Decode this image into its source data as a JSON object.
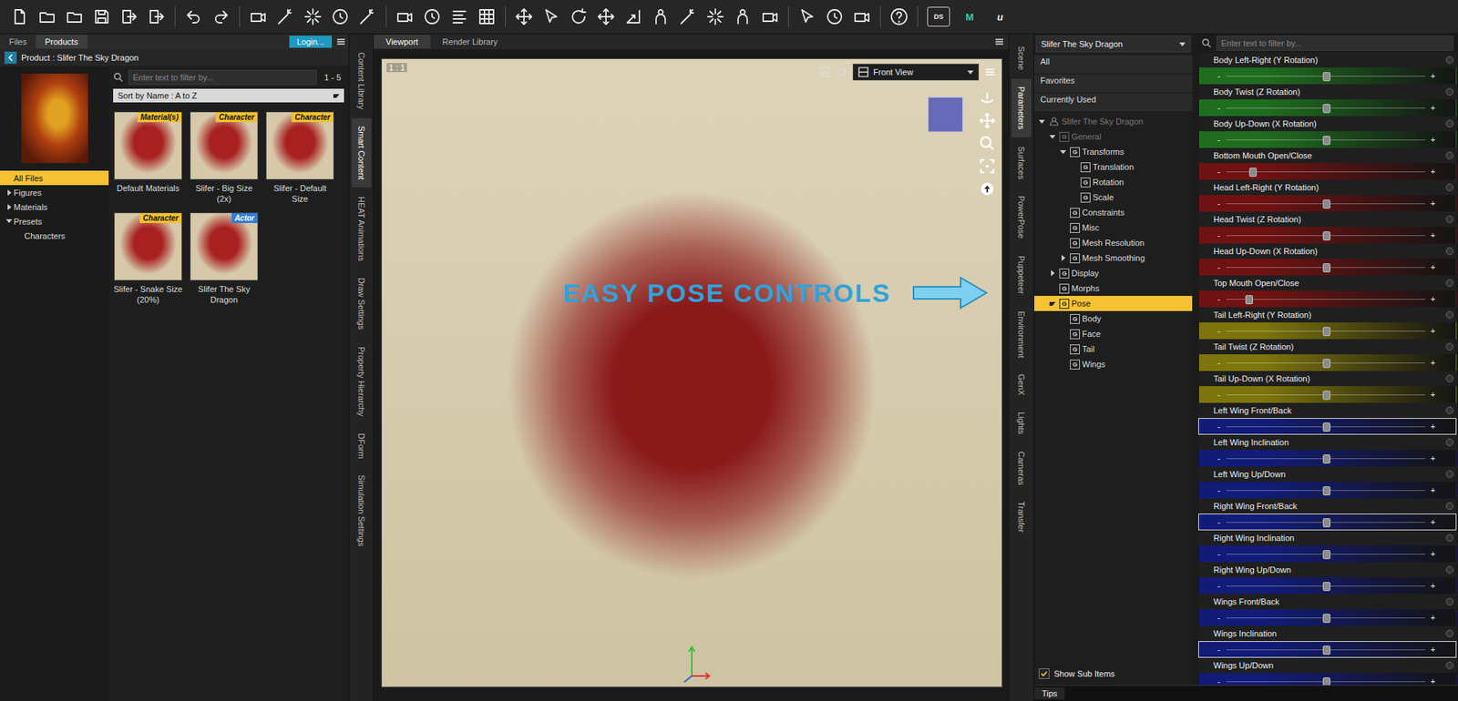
{
  "toolbar": {
    "tagged_icons": [
      {
        "label": "DS"
      },
      {
        "label": "M"
      },
      {
        "label": "u"
      }
    ]
  },
  "content_panel": {
    "tabs": [
      {
        "label": "Files",
        "selected": false
      },
      {
        "label": "Products",
        "selected": true
      }
    ],
    "login": "Login...",
    "breadcrumb": "Product : Slifer The Sky Dragon",
    "filter": {
      "placeholder": "Enter text to filter by...",
      "count": "1 - 5"
    },
    "sort": "Sort by Name : A to Z",
    "tree": [
      {
        "label": "All Files",
        "depth": 0,
        "expandable": false,
        "expanded": false,
        "selected": true
      },
      {
        "label": "Figures",
        "depth": 0,
        "expandable": true,
        "expanded": false,
        "selected": false
      },
      {
        "label": "Materials",
        "depth": 0,
        "expandable": true,
        "expanded": false,
        "selected": false
      },
      {
        "label": "Presets",
        "depth": 0,
        "expandable": true,
        "expanded": true,
        "selected": false
      },
      {
        "label": "Characters",
        "depth": 1,
        "expandable": false,
        "expanded": false,
        "selected": false
      }
    ],
    "items": [
      {
        "name": "Default Materials",
        "badge": "Material(s)",
        "color": "#f2c12e"
      },
      {
        "name": "Slifer - Big Size (2x)",
        "badge": "Character",
        "color": "#f2c12e"
      },
      {
        "name": "Slifer - Default Size",
        "badge": "Character",
        "color": "#f2c12e"
      },
      {
        "name": "Slifer - Snake Size (20%)",
        "badge": "Character",
        "color": "#f2c12e"
      },
      {
        "name": "Slifer The Sky Dragon",
        "badge": "Actor",
        "color": "#2f7fd8"
      }
    ]
  },
  "left_tabs": [
    {
      "label": "Content Library",
      "selected": false
    },
    {
      "label": "Smart Content",
      "selected": true
    },
    {
      "label": "HEAT Animations",
      "selected": false
    },
    {
      "label": "Draw Settings",
      "selected": false
    },
    {
      "label": "Property Hierarchy",
      "selected": false
    },
    {
      "label": "DForm",
      "selected": false
    },
    {
      "label": "Simulation Settings",
      "selected": false
    }
  ],
  "viewport": {
    "tabs": [
      {
        "label": "Viewport",
        "selected": true
      },
      {
        "label": "Render Library",
        "selected": false
      }
    ],
    "zoom": "1 : 1",
    "view": "Front View",
    "callout": "EASY POSE CONTROLS"
  },
  "right_tabs": [
    {
      "label": "Scene",
      "selected": false
    },
    {
      "label": "Parameters",
      "selected": true
    },
    {
      "label": "Surfaces",
      "selected": false
    },
    {
      "label": "PowerPose",
      "selected": false
    },
    {
      "label": "Puppeteer",
      "selected": false
    },
    {
      "label": "Environment",
      "selected": false
    },
    {
      "label": "GenX",
      "selected": false
    },
    {
      "label": "Lights",
      "selected": false
    },
    {
      "label": "Cameras",
      "selected": false
    },
    {
      "label": "Transfer",
      "selected": false
    }
  ],
  "parameters": {
    "node": "Slifer The Sky Dragon",
    "quick": [
      {
        "label": "All",
        "selected": false
      },
      {
        "label": "Favorites",
        "selected": false
      },
      {
        "label": "Currently Used",
        "selected": false
      }
    ],
    "group_badge": "G",
    "tree": [
      {
        "label": "Slifer The Sky Dragon",
        "kind": "figure",
        "depth": 0,
        "expandable": true,
        "expanded": true,
        "selected": false,
        "greyed": true
      },
      {
        "label": "General",
        "kind": "group",
        "depth": 1,
        "expandable": true,
        "expanded": true,
        "selected": false,
        "greyed": true
      },
      {
        "label": "Transforms",
        "kind": "group",
        "depth": 2,
        "expandable": true,
        "expanded": true,
        "selected": false,
        "greyed": false
      },
      {
        "label": "Translation",
        "kind": "group",
        "depth": 3,
        "expandable": false,
        "expanded": false,
        "selected": false,
        "greyed": false
      },
      {
        "label": "Rotation",
        "kind": "group",
        "depth": 3,
        "expandable": false,
        "expanded": false,
        "selected": false,
        "greyed": false
      },
      {
        "label": "Scale",
        "kind": "group",
        "depth": 3,
        "expandable": false,
        "expanded": false,
        "selected": false,
        "greyed": false
      },
      {
        "label": "Constraints",
        "kind": "group",
        "depth": 2,
        "expandable": false,
        "expanded": false,
        "selected": false,
        "greyed": false
      },
      {
        "label": "Misc",
        "kind": "group",
        "depth": 2,
        "expandable": false,
        "expanded": false,
        "selected": false,
        "greyed": false
      },
      {
        "label": "Mesh Resolution",
        "kind": "group",
        "depth": 2,
        "expandable": false,
        "expanded": false,
        "selected": false,
        "greyed": false
      },
      {
        "label": "Mesh Smoothing",
        "kind": "group",
        "depth": 2,
        "expandable": true,
        "expanded": false,
        "selected": false,
        "greyed": false
      },
      {
        "label": "Display",
        "kind": "group",
        "depth": 1,
        "expandable": true,
        "expanded": false,
        "selected": false,
        "greyed": false
      },
      {
        "label": "Morphs",
        "kind": "group",
        "depth": 1,
        "expandable": false,
        "expanded": false,
        "selected": false,
        "greyed": false
      },
      {
        "label": "Pose",
        "kind": "group",
        "depth": 1,
        "expandable": true,
        "expanded": true,
        "selected": true,
        "greyed": false
      },
      {
        "label": "Body",
        "kind": "group",
        "depth": 2,
        "expandable": false,
        "expanded": false,
        "selected": false,
        "greyed": false
      },
      {
        "label": "Face",
        "kind": "group",
        "depth": 2,
        "expandable": false,
        "expanded": false,
        "selected": false,
        "greyed": false
      },
      {
        "label": "Tail",
        "kind": "group",
        "depth": 2,
        "expandable": false,
        "expanded": false,
        "selected": false,
        "greyed": false
      },
      {
        "label": "Wings",
        "kind": "group",
        "depth": 2,
        "expandable": false,
        "expanded": false,
        "selected": false,
        "greyed": false
      }
    ],
    "show_sub_items": {
      "label": "Show Sub Items",
      "checked": true
    },
    "filter": {
      "placeholder": "Enter text to filter by..."
    },
    "slider_minus": "-",
    "slider_plus": "+",
    "sliders": [
      {
        "name": "Body Left-Right (Y Rotation)",
        "level": 0.5,
        "color": "#1f6e1f",
        "outlined": false
      },
      {
        "name": "Body Twist (Z Rotation)",
        "level": 0.5,
        "color": "#1f6e1f",
        "outlined": false
      },
      {
        "name": "Body Up-Down (X Rotation)",
        "level": 0.5,
        "color": "#1f6e1f",
        "outlined": false
      },
      {
        "name": "Bottom Mouth Open/Close",
        "level": 0.13,
        "color": "#701212",
        "outlined": false
      },
      {
        "name": "Head Left-Right (Y Rotation)",
        "level": 0.5,
        "color": "#701212",
        "outlined": false
      },
      {
        "name": "Head Twist (Z Rotation)",
        "level": 0.5,
        "color": "#701212",
        "outlined": false
      },
      {
        "name": "Head Up-Down (X Rotation)",
        "level": 0.5,
        "color": "#701212",
        "outlined": false
      },
      {
        "name": "Top Mouth Open/Close",
        "level": 0.11,
        "color": "#701212",
        "outlined": false
      },
      {
        "name": "Tail Left-Right (Y Rotation)",
        "level": 0.5,
        "color": "#7d750c",
        "outlined": false
      },
      {
        "name": "Tail Twist (Z Rotation)",
        "level": 0.5,
        "color": "#7d750c",
        "outlined": false
      },
      {
        "name": "Tail Up-Down (X Rotation)",
        "level": 0.5,
        "color": "#7d750c",
        "outlined": false
      },
      {
        "name": "Left Wing Front/Back",
        "level": 0.5,
        "color": "#121c78",
        "outlined": true
      },
      {
        "name": "Left Wing Inclination",
        "level": 0.5,
        "color": "#121c78",
        "outlined": false
      },
      {
        "name": "Left Wing Up/Down",
        "level": 0.5,
        "color": "#121c78",
        "outlined": false
      },
      {
        "name": "Right Wing Front/Back",
        "level": 0.5,
        "color": "#121c78",
        "outlined": true
      },
      {
        "name": "Right Wing Inclination",
        "level": 0.5,
        "color": "#121c78",
        "outlined": false
      },
      {
        "name": "Right Wing Up/Down",
        "level": 0.5,
        "color": "#121c78",
        "outlined": false
      },
      {
        "name": "Wings Front/Back",
        "level": 0.5,
        "color": "#121c78",
        "outlined": false
      },
      {
        "name": "Wings Inclination",
        "level": 0.5,
        "color": "#121c78",
        "outlined": true
      },
      {
        "name": "Wings Up/Down",
        "level": 0.5,
        "color": "#121c78",
        "outlined": false
      }
    ]
  },
  "tips": "Tips"
}
